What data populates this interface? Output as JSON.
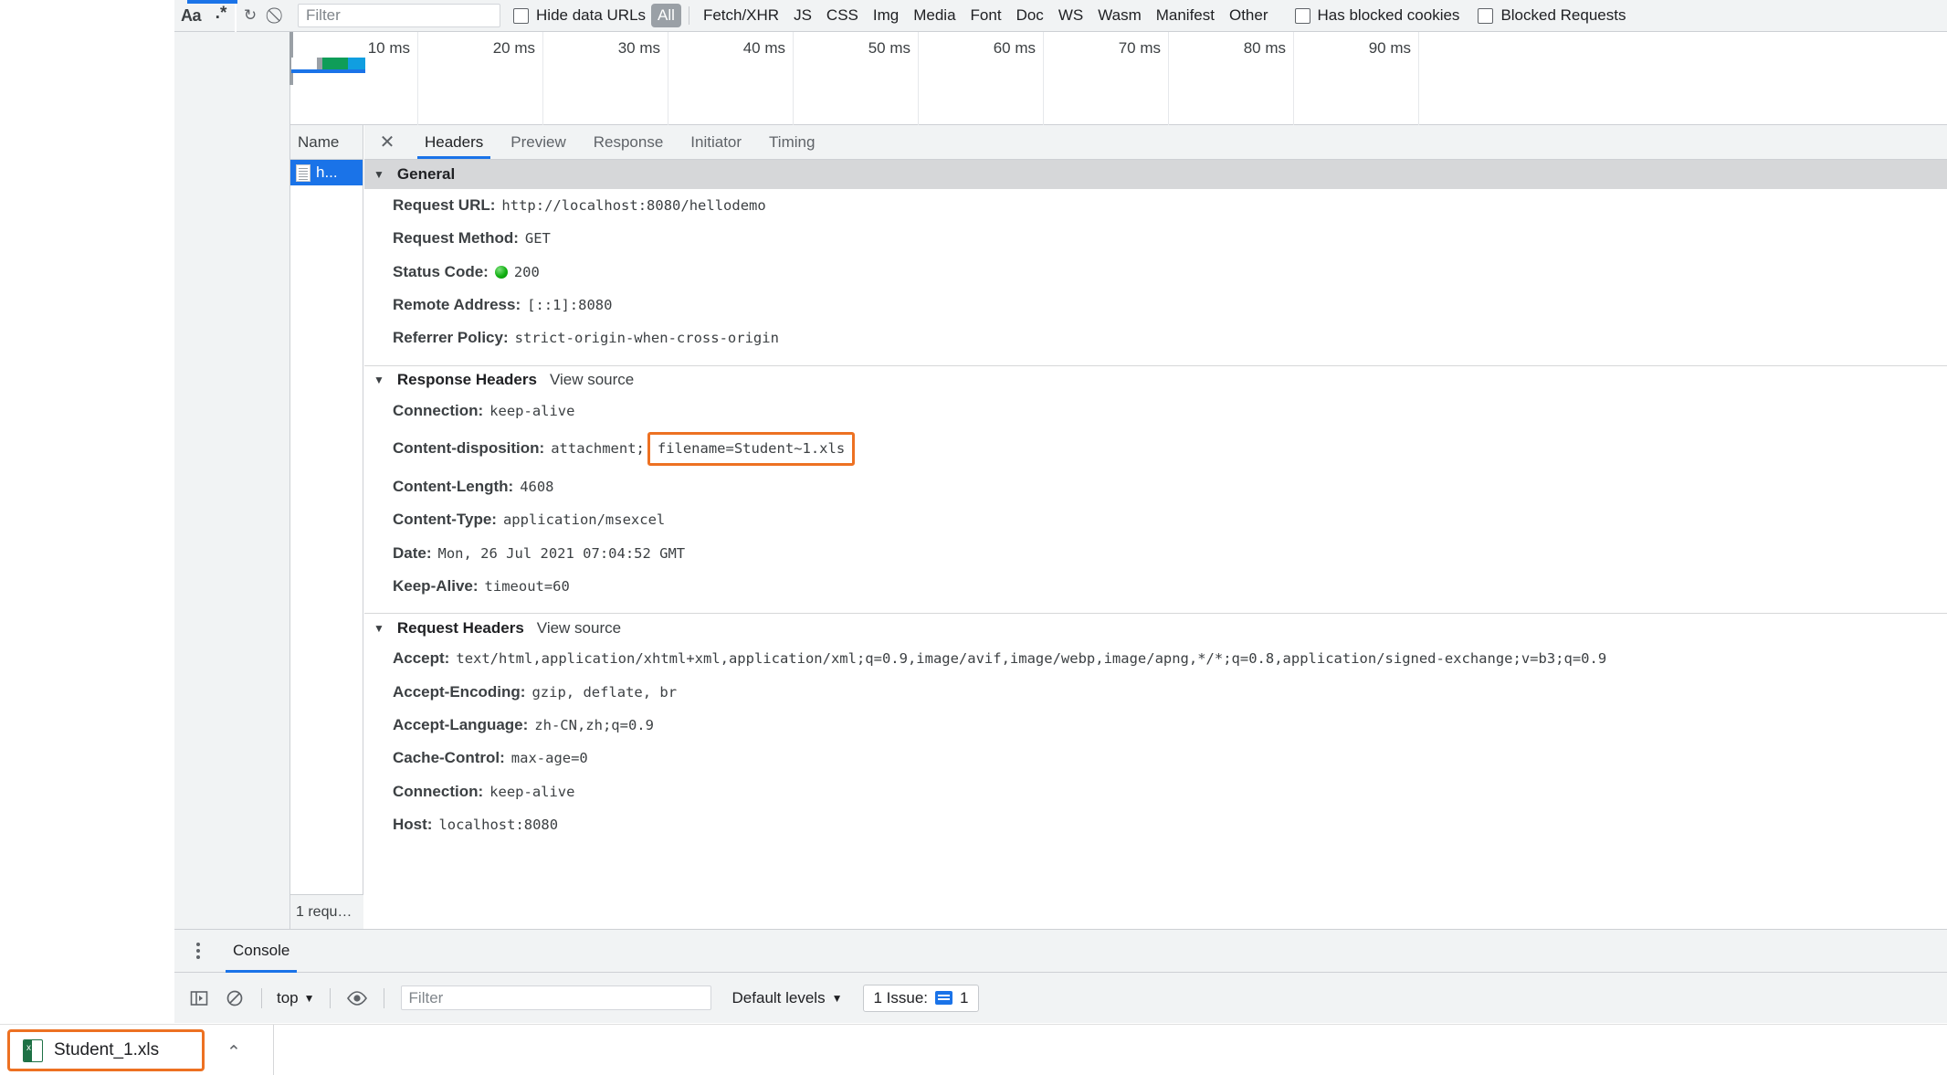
{
  "network_toolbar": {
    "icons": [
      {
        "name": "match-case-icon",
        "glyph": "Aa"
      },
      {
        "name": "use-regex-icon",
        "glyph": ".*"
      },
      {
        "name": "reload-icon",
        "glyph": "↻"
      },
      {
        "name": "clear-icon",
        "glyph": "⃠"
      }
    ],
    "filter_placeholder": "Filter",
    "filter_value": "",
    "hide_data_urls_label": "Hide data URLs",
    "hide_data_urls_checked": false,
    "resource_types": [
      "All",
      "Fetch/XHR",
      "JS",
      "CSS",
      "Img",
      "Media",
      "Font",
      "Doc",
      "WS",
      "Wasm",
      "Manifest",
      "Other"
    ],
    "active_resource_type": "All",
    "has_blocked_cookies_label": "Has blocked cookies",
    "has_blocked_cookies_checked": false,
    "blocked_requests_label": "Blocked Requests",
    "blocked_requests_checked": false
  },
  "overview": {
    "ticks": [
      "10 ms",
      "20 ms",
      "30 ms",
      "40 ms",
      "50 ms",
      "60 ms",
      "70 ms",
      "80 ms",
      "90 ms"
    ],
    "bar_segments": [
      {
        "name": "stalled",
        "color": "#ffffff"
      },
      {
        "name": "dns",
        "color": "#9aa0a6"
      },
      {
        "name": "waiting",
        "color": "#0f9d58"
      },
      {
        "name": "download",
        "color": "#109ee0"
      }
    ],
    "bar_underline_color": "#1a73e8"
  },
  "request_list": {
    "column_header": "Name",
    "rows": [
      {
        "name": "h...",
        "icon": "document-icon",
        "selected": true
      }
    ],
    "footer_text": "1 requ…"
  },
  "details": {
    "tabs": [
      "Headers",
      "Preview",
      "Response",
      "Initiator",
      "Timing"
    ],
    "active_tab": "Headers",
    "close_glyph": "✕",
    "sections": [
      {
        "title": "General",
        "style": "shaded",
        "view_source": null,
        "rows": [
          {
            "name": "Request URL:",
            "value": "http://localhost:8080/hellodemo"
          },
          {
            "name": "Request Method:",
            "value": "GET"
          },
          {
            "name": "Status Code:",
            "value": "200",
            "status_dot": true
          },
          {
            "name": "Remote Address:",
            "value": "[::1]:8080"
          },
          {
            "name": "Referrer Policy:",
            "value": "strict-origin-when-cross-origin"
          }
        ]
      },
      {
        "title": "Response Headers",
        "style": "plain",
        "view_source": "View source",
        "rows": [
          {
            "name": "Connection:",
            "value": "keep-alive"
          },
          {
            "name": "Content-disposition:",
            "value": "attachment;",
            "highlighted_value": "filename=Student~1.xls"
          },
          {
            "name": "Content-Length:",
            "value": "4608"
          },
          {
            "name": "Content-Type:",
            "value": "application/msexcel"
          },
          {
            "name": "Date:",
            "value": "Mon, 26 Jul 2021 07:04:52 GMT"
          },
          {
            "name": "Keep-Alive:",
            "value": "timeout=60"
          }
        ]
      },
      {
        "title": "Request Headers",
        "style": "plain",
        "view_source": "View source",
        "rows": [
          {
            "name": "Accept:",
            "value": "text/html,application/xhtml+xml,application/xml;q=0.9,image/avif,image/webp,image/apng,*/*;q=0.8,application/signed-exchange;v=b3;q=0.9"
          },
          {
            "name": "Accept-Encoding:",
            "value": "gzip, deflate, br"
          },
          {
            "name": "Accept-Language:",
            "value": "zh-CN,zh;q=0.9"
          },
          {
            "name": "Cache-Control:",
            "value": "max-age=0"
          },
          {
            "name": "Connection:",
            "value": "keep-alive"
          },
          {
            "name": "Host:",
            "value": "localhost:8080"
          }
        ]
      }
    ]
  },
  "drawer": {
    "tabs": [
      "Console"
    ],
    "active_tab": "Console",
    "toolbar": {
      "sidebar_icon": "show-console-sidebar-icon",
      "clear_icon": "clear-console-icon",
      "context_value": "top",
      "eye_icon": "live-expression-icon",
      "filter_placeholder": "Filter",
      "filter_value": "",
      "levels_label": "Default levels",
      "issues_label": "1 Issue:",
      "issues_count": "1"
    }
  },
  "download_shelf": {
    "file_name": "Student_1.xls",
    "file_icon": "excel-file-icon",
    "menu_glyph": "⌃"
  },
  "colors": {
    "accent_blue": "#1a73e8",
    "highlight_orange": "#ed7122",
    "toolbar_bg": "#f1f3f4",
    "status_green": "#12b012"
  }
}
